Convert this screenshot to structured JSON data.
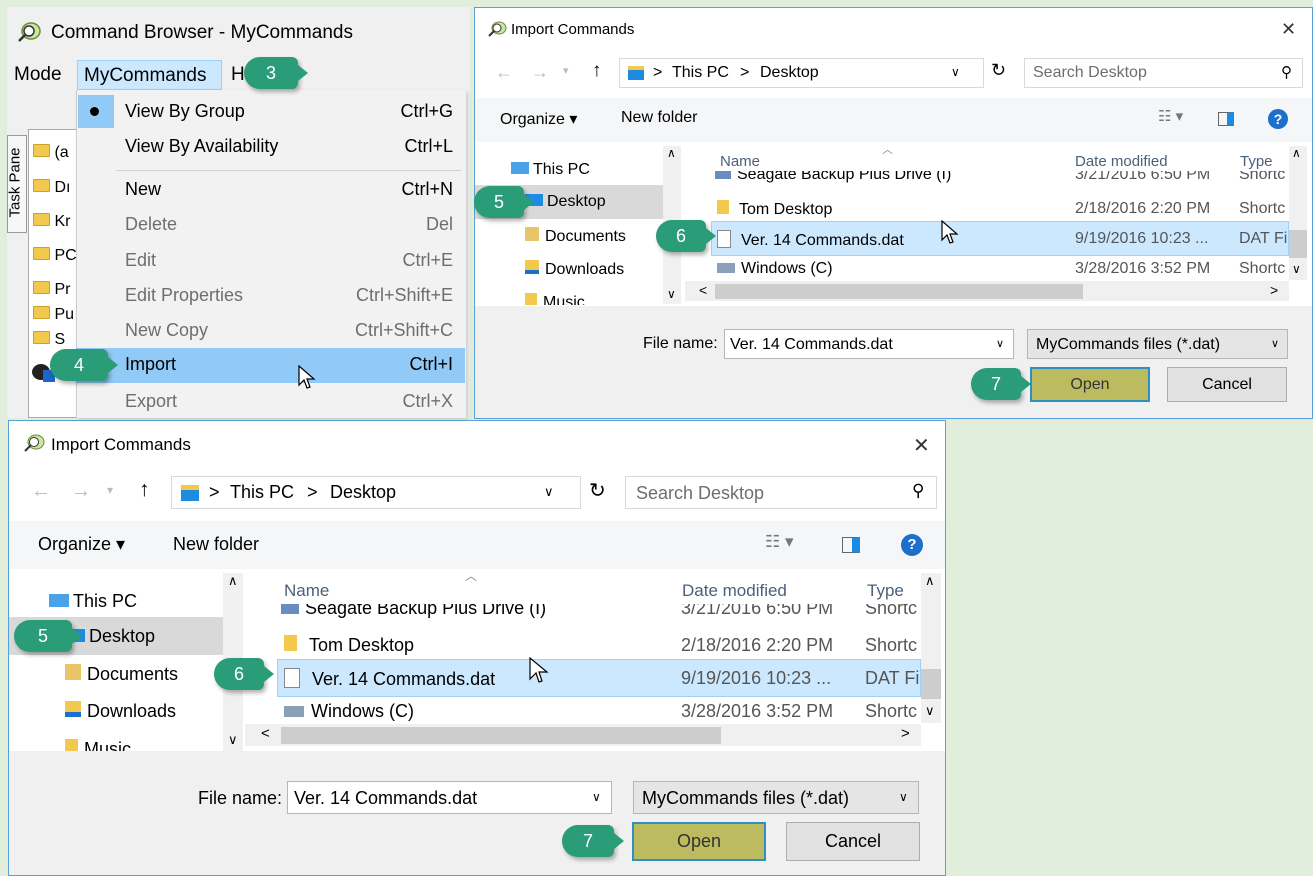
{
  "callouts": {
    "c3": "3",
    "c4": "4",
    "c5": "5",
    "c6": "6",
    "c7": "7"
  },
  "command_browser": {
    "title": "Command Browser - MyCommands",
    "menubar": {
      "mode": "Mode",
      "mycommands": "MyCommands",
      "h": "H"
    },
    "task_pane_label": "Task Pane",
    "tree_items": [
      "(a",
      "Dı",
      "Kr",
      "PC",
      "Pr",
      "Pu",
      "S"
    ],
    "menu": {
      "view_by_group": {
        "label": "View By Group",
        "shortcut": "Ctrl+G"
      },
      "view_by_availability": {
        "label": "View By Availability",
        "shortcut": "Ctrl+L"
      },
      "new": {
        "label": "New",
        "shortcut": "Ctrl+N"
      },
      "delete": {
        "label": "Delete",
        "shortcut": "Del"
      },
      "edit": {
        "label": "Edit",
        "shortcut": "Ctrl+E"
      },
      "edit_properties": {
        "label": "Edit Properties",
        "shortcut": "Ctrl+Shift+E"
      },
      "new_copy": {
        "label": "New Copy",
        "shortcut": "Ctrl+Shift+C"
      },
      "import": {
        "label": "Import",
        "shortcut": "Ctrl+I"
      },
      "export": {
        "label": "Export",
        "shortcut": "Ctrl+X"
      }
    }
  },
  "dialog": {
    "title": "Import Commands",
    "close": "✕",
    "breadcrumb": {
      "this_pc": "This PC",
      "desktop": "Desktop",
      "sep": ">"
    },
    "search_placeholder": "Search Desktop",
    "toolbar": {
      "organize": "Organize ▾",
      "new_folder": "New folder"
    },
    "nav": {
      "this_pc": "This PC",
      "desktop": "Desktop",
      "documents": "Documents",
      "downloads": "Downloads",
      "music": "Music"
    },
    "columns": {
      "name": "Name",
      "date": "Date modified",
      "type": "Type"
    },
    "files": [
      {
        "name": "Seagate Backup Plus Drive (I)",
        "date": "3/21/2016 6:50 PM",
        "type": "Shortc"
      },
      {
        "name": "Tom Desktop",
        "date": "2/18/2016 2:20 PM",
        "type": "Shortc"
      },
      {
        "name": "Ver. 14 Commands.dat",
        "date": "9/19/2016 10:23 ...",
        "type": "DAT Fi"
      },
      {
        "name": "Windows (C)",
        "date": "3/28/2016 3:52 PM",
        "type": "Shortc"
      }
    ],
    "file_name_label": "File name:",
    "file_name_value": "Ver. 14 Commands.dat",
    "filter": "MyCommands files (*.dat)",
    "open": "Open",
    "cancel": "Cancel"
  },
  "colors": {
    "callout": "#2a9c78",
    "background": "#e2eedc",
    "selection": "#cce8ff",
    "menu_highlight": "#91c9f7",
    "open_button": "#bdbb5f"
  }
}
